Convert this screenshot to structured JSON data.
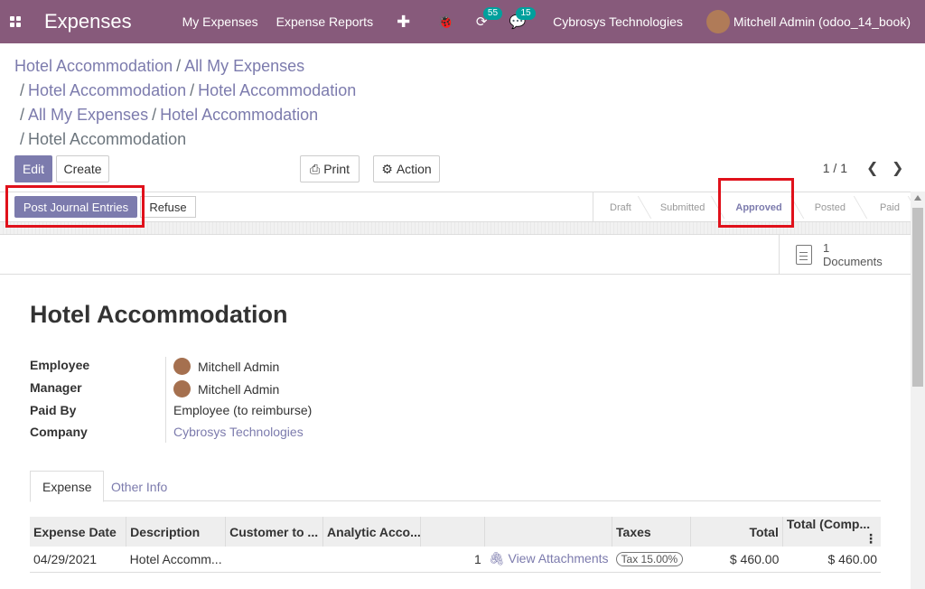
{
  "navbar": {
    "app_title": "Expenses",
    "menu": [
      "My Expenses",
      "Expense Reports"
    ],
    "activity_count": "55",
    "messages_count": "15",
    "company": "Cybrosys Technologies",
    "user": "Mitchell Admin (odoo_14_book)"
  },
  "breadcrumbs": {
    "items": [
      "Hotel Accommodation",
      "All My Expenses",
      "Hotel Accommodation",
      "Hotel Accommodation",
      "All My Expenses",
      "Hotel Accommodation"
    ],
    "current": "Hotel Accommodation"
  },
  "toolbar": {
    "edit": "Edit",
    "create": "Create",
    "print": "Print",
    "action": "Action",
    "pager": "1 / 1"
  },
  "statusbar": {
    "post": "Post Journal Entries",
    "refuse": "Refuse",
    "stages": [
      "Draft",
      "Submitted",
      "Approved",
      "Posted",
      "Paid"
    ],
    "current_stage": "Approved"
  },
  "documents": {
    "count": "1",
    "label": "Documents"
  },
  "form": {
    "title": "Hotel Accommodation",
    "fields": {
      "employee_label": "Employee",
      "employee": "Mitchell Admin",
      "manager_label": "Manager",
      "manager": "Mitchell Admin",
      "paid_by_label": "Paid By",
      "paid_by": "Employee (to reimburse)",
      "company_label": "Company",
      "company": "Cybrosys Technologies"
    }
  },
  "tabs": [
    "Expense",
    "Other Info"
  ],
  "lines": {
    "headers": [
      "Expense Date",
      "Description",
      "Customer to ...",
      "Analytic Acco...",
      "",
      "",
      "Taxes",
      "Total",
      "Total (Comp..."
    ],
    "rows": [
      {
        "date": "04/29/2021",
        "description": "Hotel Accomm...",
        "customer": "",
        "analytic": "",
        "qty": "1",
        "attachments": "View Attachments",
        "taxes": "Tax 15.00%",
        "total": "$ 460.00",
        "total_company": "$ 460.00"
      }
    ]
  }
}
